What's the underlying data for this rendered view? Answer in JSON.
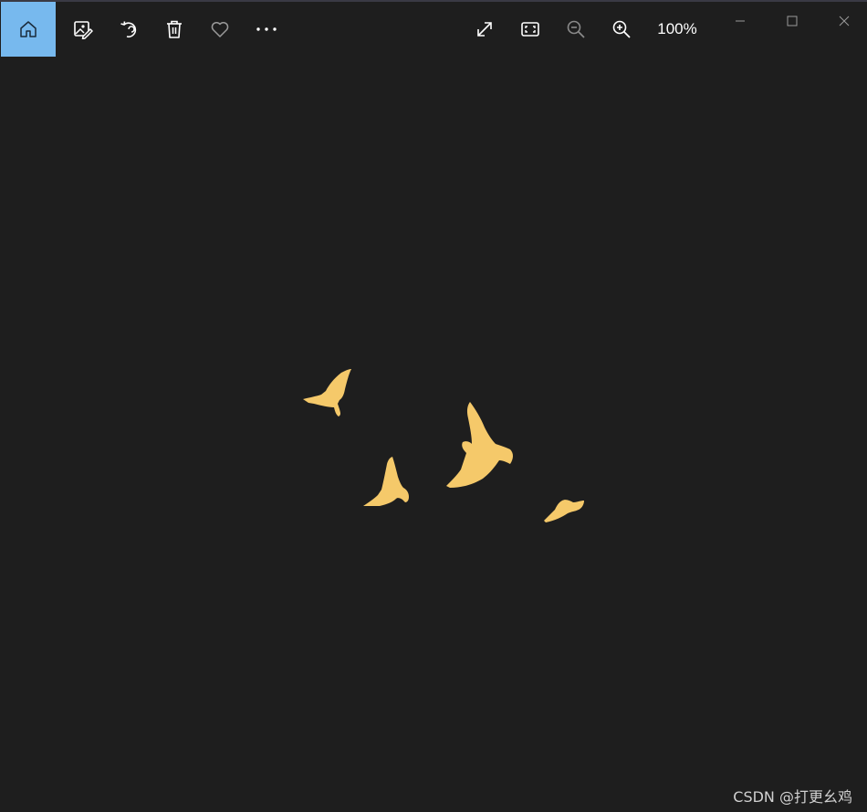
{
  "toolbar": {
    "home_icon": "home-icon",
    "edit_icon": "edit-image-icon",
    "rotate_icon": "rotate-icon",
    "delete_icon": "trash-icon",
    "favorite_icon": "heart-icon",
    "more_icon": "more-icon",
    "fullscreen_icon": "expand-icon",
    "fit_icon": "fit-to-window-icon",
    "zoom_out_icon": "zoom-out-icon",
    "zoom_in_icon": "zoom-in-icon",
    "zoom_level": "100%"
  },
  "window_controls": {
    "minimize_icon": "minimize-icon",
    "maximize_icon": "maximize-icon",
    "close_icon": "close-icon"
  },
  "image": {
    "subject": "birds",
    "bird_color": "#f5c96a",
    "background_color": "#1e1e1e"
  },
  "colors": {
    "accent": "#77b9ee",
    "toolbar_icon": "#ffffff",
    "disabled_icon": "#8a8a8a"
  },
  "watermark": "CSDN @打更幺鸡"
}
